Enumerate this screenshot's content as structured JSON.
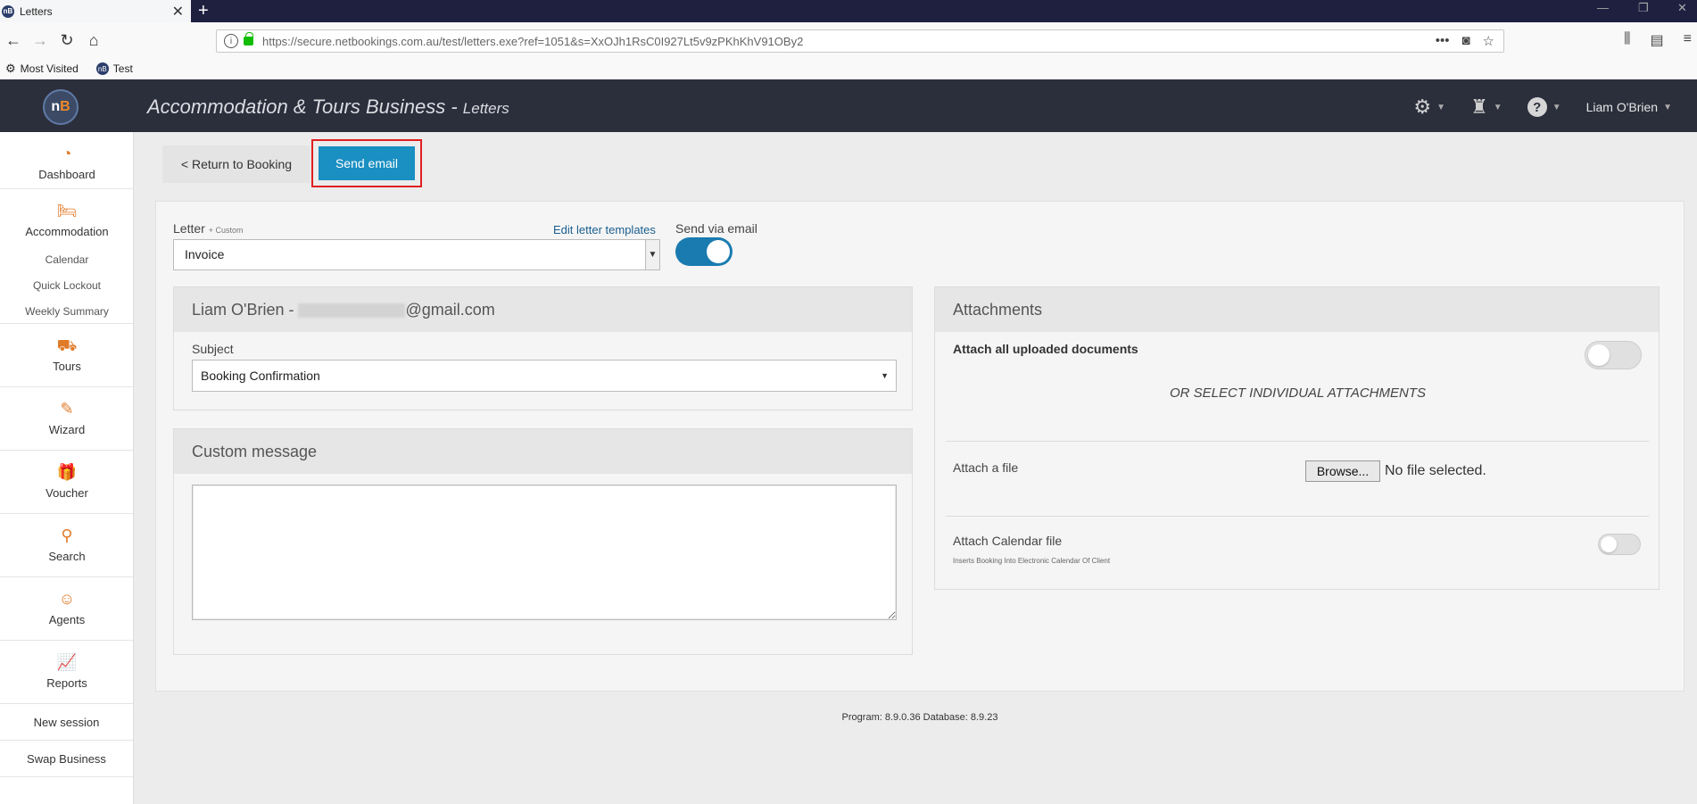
{
  "browser": {
    "tab_title": "Letters",
    "tab_favicon": "nB",
    "new_tab_label": "+",
    "url": "https://secure.netbookings.com.au/test/letters.exe?ref=1051&s=XxOJh1RsC0I927Lt5v9zPKhKhV91OBy2",
    "bookmarks": [
      {
        "label": "Most Visited",
        "icon": "gear-icon"
      },
      {
        "label": "Test",
        "icon": "netbookings-logo"
      }
    ]
  },
  "header": {
    "logo": "nB",
    "title": "Accommodation & Tours Business -",
    "subtitle": "Letters",
    "user_name": "Liam O'Brien"
  },
  "sidebar": {
    "items": [
      {
        "label": "Dashboard",
        "icon": "speedometer-icon"
      },
      {
        "label": "Accommodation",
        "icon": "bed-icon"
      },
      {
        "label": "Tours",
        "icon": "tour-icon"
      },
      {
        "label": "Wizard",
        "icon": "wand-icon"
      },
      {
        "label": "Voucher",
        "icon": "gift-icon"
      },
      {
        "label": "Search",
        "icon": "search-icon"
      },
      {
        "label": "Agents",
        "icon": "agent-icon"
      },
      {
        "label": "Reports",
        "icon": "chart-icon"
      }
    ],
    "sub_items": [
      "Calendar",
      "Quick Lockout",
      "Weekly Summary"
    ],
    "new_session": "New session",
    "swap_business": "Swap Business"
  },
  "toolbar": {
    "return_label": "< Return to Booking",
    "send_label": "Send email"
  },
  "letter": {
    "label": "Letter",
    "label_note": "+ Custom",
    "edit_templates": "Edit letter templates",
    "selected": "Invoice",
    "send_via_label": "Send via email",
    "send_via_on": true
  },
  "recipient": {
    "name_prefix": "Liam O'Brien -",
    "email_suffix": "@gmail.com",
    "subject_label": "Subject",
    "subject_value": "Booking Confirmation"
  },
  "custom_message": {
    "heading": "Custom message",
    "value": ""
  },
  "attachments": {
    "heading": "Attachments",
    "attach_all_label": "Attach all uploaded documents",
    "attach_all_on": false,
    "or_select": "OR SELECT INDIVIDUAL ATTACHMENTS",
    "attach_file_label": "Attach a file",
    "browse_label": "Browse...",
    "no_file": "No file selected.",
    "calendar_label": "Attach Calendar file",
    "calendar_note": "Inserts Booking Into Electronic Calendar Of Client",
    "calendar_on": false
  },
  "footer": {
    "version": "Program: 8.9.0.36 Database: 8.9.23"
  },
  "colors": {
    "header_bg": "#2b2e3b",
    "accent": "#1a8fc2",
    "highlight_border": "#e02020",
    "sidebar_icon": "#e07b2a"
  }
}
